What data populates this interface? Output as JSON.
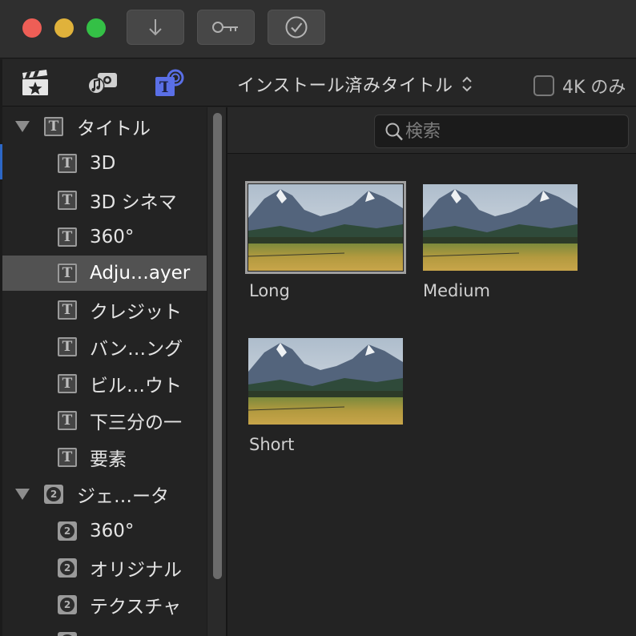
{
  "window": {
    "controls": [
      "close",
      "minimize",
      "maximize"
    ],
    "toolbar_buttons": [
      {
        "icon": "download-arrow-icon"
      },
      {
        "icon": "key-icon"
      },
      {
        "icon": "checkmark-circle-icon"
      }
    ]
  },
  "toolbar": {
    "icons": [
      "clapperboard-star-icon",
      "music-photo-icon",
      "titles-icon"
    ],
    "dropdown_label": "インストール済みタイトル",
    "checkbox_label": "4K のみ",
    "checkbox_checked": false
  },
  "search": {
    "placeholder": "検索"
  },
  "sidebar": {
    "items": [
      {
        "label": "タイトル",
        "kind": "category",
        "icon": "title-t-icon",
        "expanded": true
      },
      {
        "label": "3D",
        "kind": "item",
        "icon": "title-t-icon"
      },
      {
        "label": "3D シネマ",
        "kind": "item",
        "icon": "title-t-icon"
      },
      {
        "label": "360°",
        "kind": "item",
        "icon": "title-t-icon"
      },
      {
        "label": "Adju…ayer",
        "kind": "item",
        "icon": "title-t-icon",
        "selected": true
      },
      {
        "label": "クレジット",
        "kind": "item",
        "icon": "title-t-icon"
      },
      {
        "label": "バン…ング",
        "kind": "item",
        "icon": "title-t-icon"
      },
      {
        "label": "ビル…ウト",
        "kind": "item",
        "icon": "title-t-icon"
      },
      {
        "label": "下三分の一",
        "kind": "item",
        "icon": "title-t-icon"
      },
      {
        "label": "要素",
        "kind": "item",
        "icon": "title-t-icon"
      },
      {
        "label": "ジェ…ータ",
        "kind": "category",
        "icon": "generator-icon",
        "expanded": true
      },
      {
        "label": "360°",
        "kind": "item",
        "icon": "generator-icon"
      },
      {
        "label": "オリジナル",
        "kind": "item",
        "icon": "generator-icon"
      },
      {
        "label": "テクスチャ",
        "kind": "item",
        "icon": "generator-icon"
      }
    ]
  },
  "browser": {
    "items": [
      {
        "label": "Long",
        "selected": true
      },
      {
        "label": "Medium",
        "selected": false
      },
      {
        "label": "Short",
        "selected": false
      }
    ]
  },
  "colors": {
    "accent_blue": "#5a6fe6",
    "close": "#ee5e56",
    "minimize": "#e0b23b",
    "maximize": "#34c046",
    "selection": "#525252"
  }
}
